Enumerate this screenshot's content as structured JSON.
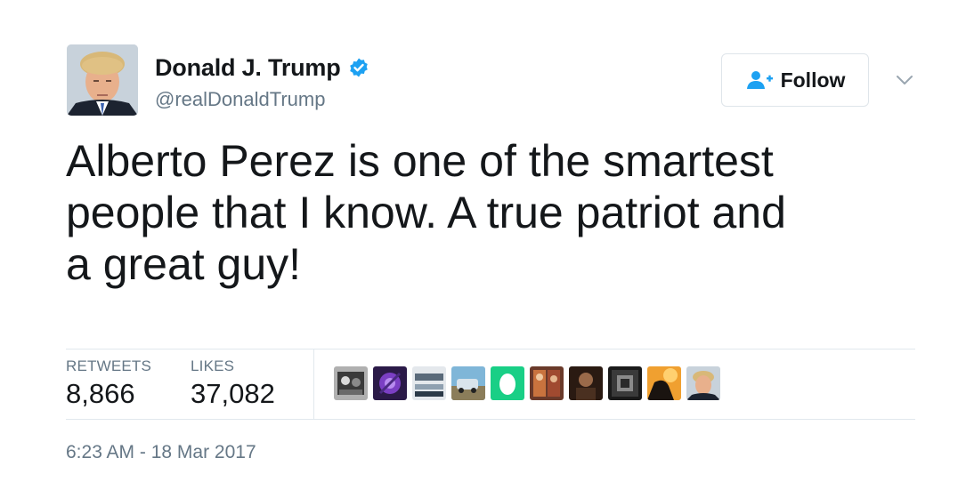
{
  "author": {
    "name": "Donald J. Trump",
    "handle": "@realDonaldTrump",
    "verified": true
  },
  "header": {
    "follow_label": "Follow"
  },
  "tweet": {
    "text": "Alberto Perez is one of the smartest people that I know. A true patriot and a great guy!",
    "timestamp": "6:23 AM - 18 Mar 2017"
  },
  "stats": {
    "retweets_label": "RETWEETS",
    "retweets_value": "8,866",
    "likes_label": "LIKES",
    "likes_value": "37,082"
  },
  "colors": {
    "verified_blue": "#1da1f2",
    "follow_icon_blue": "#1da1f2",
    "text_primary": "#14171a",
    "text_secondary": "#657786",
    "divider": "#e1e8ed",
    "egg_green": "#19cf86"
  }
}
